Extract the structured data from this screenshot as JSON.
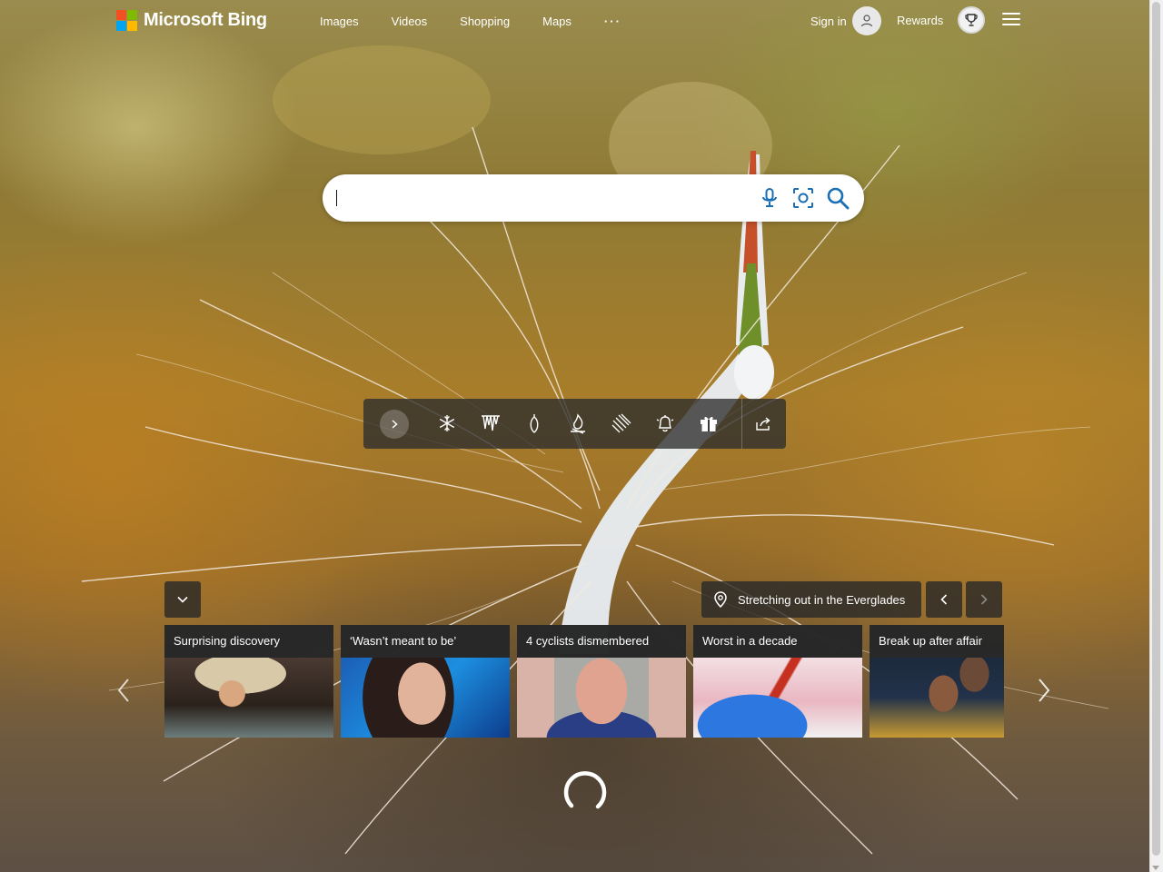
{
  "header": {
    "brand": "Microsoft Bing",
    "nav": [
      "Images",
      "Videos",
      "Shopping",
      "Maps"
    ],
    "more": "···",
    "signin_label": "Sign in",
    "rewards_label": "Rewards"
  },
  "search": {
    "value": "",
    "icons": [
      "microphone-icon",
      "visual-search-icon",
      "search-icon"
    ]
  },
  "theme_toolbar": {
    "icons": [
      "snowflake-icon",
      "icicles-icon",
      "ornament-icon",
      "fire-icon",
      "snow-sled-icon",
      "bell-icon",
      "gift-icon",
      "share-icon"
    ]
  },
  "image_info": {
    "location_title": "Stretching out in the Everglades"
  },
  "news": [
    {
      "title": "Surprising discovery"
    },
    {
      "title": "‘Wasn’t meant to be’"
    },
    {
      "title": "4 cyclists dismembered"
    },
    {
      "title": "Worst in a decade"
    },
    {
      "title": "Break up after affair"
    }
  ],
  "colors": {
    "ms_red": "#f25022",
    "ms_green": "#7fba00",
    "ms_blue": "#00a4ef",
    "ms_yellow": "#ffb900",
    "search_icon": "#1a6fb5"
  }
}
